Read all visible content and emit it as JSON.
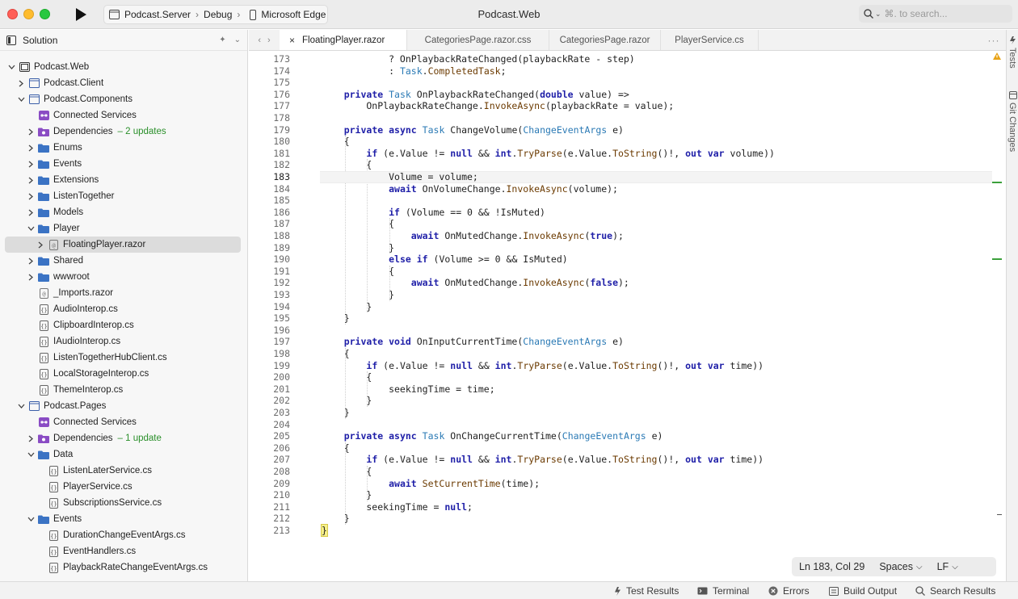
{
  "window": {
    "title": "Podcast.Web",
    "target": {
      "project": "Podcast.Server",
      "config": "Debug",
      "device": "Microsoft Edge"
    },
    "search_placeholder": "⌘. to search..."
  },
  "solution": {
    "header": "Solution",
    "items": [
      {
        "label": "Podcast.Web",
        "depth": 0,
        "chevron": "down",
        "icon": "solution-icon"
      },
      {
        "label": "Podcast.Client",
        "depth": 1,
        "chevron": "right",
        "icon": "project-icon"
      },
      {
        "label": "Podcast.Components",
        "depth": 1,
        "chevron": "down",
        "icon": "project-icon"
      },
      {
        "label": "Connected Services",
        "depth": 2,
        "chevron": "",
        "icon": "connected-services-icon"
      },
      {
        "label": "Dependencies",
        "badge": "– 2 updates",
        "depth": 2,
        "chevron": "right",
        "icon": "dependencies-icon"
      },
      {
        "label": "Enums",
        "depth": 2,
        "chevron": "right",
        "icon": "folder-icon"
      },
      {
        "label": "Events",
        "depth": 2,
        "chevron": "right",
        "icon": "folder-icon"
      },
      {
        "label": "Extensions",
        "depth": 2,
        "chevron": "right",
        "icon": "folder-icon"
      },
      {
        "label": "ListenTogether",
        "depth": 2,
        "chevron": "right",
        "icon": "folder-icon"
      },
      {
        "label": "Models",
        "depth": 2,
        "chevron": "right",
        "icon": "folder-icon"
      },
      {
        "label": "Player",
        "depth": 2,
        "chevron": "down",
        "icon": "folder-icon"
      },
      {
        "label": "FloatingPlayer.razor",
        "depth": 3,
        "chevron": "right",
        "icon": "razor-file-icon",
        "selected": true
      },
      {
        "label": "Shared",
        "depth": 2,
        "chevron": "right",
        "icon": "folder-icon"
      },
      {
        "label": "wwwroot",
        "depth": 2,
        "chevron": "right",
        "icon": "folder-icon"
      },
      {
        "label": "_Imports.razor",
        "depth": 2,
        "chevron": "",
        "icon": "razor-file-icon"
      },
      {
        "label": "AudioInterop.cs",
        "depth": 2,
        "chevron": "",
        "icon": "cs-file-icon"
      },
      {
        "label": "ClipboardInterop.cs",
        "depth": 2,
        "chevron": "",
        "icon": "cs-file-icon"
      },
      {
        "label": "IAudioInterop.cs",
        "depth": 2,
        "chevron": "",
        "icon": "cs-file-icon"
      },
      {
        "label": "ListenTogetherHubClient.cs",
        "depth": 2,
        "chevron": "",
        "icon": "cs-file-icon"
      },
      {
        "label": "LocalStorageInterop.cs",
        "depth": 2,
        "chevron": "",
        "icon": "cs-file-icon"
      },
      {
        "label": "ThemeInterop.cs",
        "depth": 2,
        "chevron": "",
        "icon": "cs-file-icon"
      },
      {
        "label": "Podcast.Pages",
        "depth": 1,
        "chevron": "down",
        "icon": "project-icon"
      },
      {
        "label": "Connected Services",
        "depth": 2,
        "chevron": "",
        "icon": "connected-services-icon"
      },
      {
        "label": "Dependencies",
        "badge": "– 1 update",
        "depth": 2,
        "chevron": "right",
        "icon": "dependencies-icon"
      },
      {
        "label": "Data",
        "depth": 2,
        "chevron": "down",
        "icon": "folder-icon"
      },
      {
        "label": "ListenLaterService.cs",
        "depth": 3,
        "chevron": "",
        "icon": "cs-file-icon"
      },
      {
        "label": "PlayerService.cs",
        "depth": 3,
        "chevron": "",
        "icon": "cs-file-icon"
      },
      {
        "label": "SubscriptionsService.cs",
        "depth": 3,
        "chevron": "",
        "icon": "cs-file-icon"
      },
      {
        "label": "Events",
        "depth": 2,
        "chevron": "down",
        "icon": "folder-icon"
      },
      {
        "label": "DurationChangeEventArgs.cs",
        "depth": 3,
        "chevron": "",
        "icon": "cs-file-icon"
      },
      {
        "label": "EventHandlers.cs",
        "depth": 3,
        "chevron": "",
        "icon": "cs-file-icon"
      },
      {
        "label": "PlaybackRateChangeEventArgs.cs",
        "depth": 3,
        "chevron": "",
        "icon": "cs-file-icon"
      }
    ]
  },
  "tabs": [
    {
      "label": "FloatingPlayer.razor",
      "active": true
    },
    {
      "label": "CategoriesPage.razor.css",
      "active": false
    },
    {
      "label": "CategoriesPage.razor",
      "active": false
    },
    {
      "label": "PlayerService.cs",
      "active": false
    }
  ],
  "editor": {
    "current_line": 183,
    "lines": [
      {
        "n": "173",
        "code": "            ? OnPlaybackRateChanged(playbackRate - step)"
      },
      {
        "n": "174",
        "code": "            : Task.CompletedTask;"
      },
      {
        "n": "175",
        "code": ""
      },
      {
        "n": "176",
        "code": "    private Task OnPlaybackRateChanged(double value) =>"
      },
      {
        "n": "177",
        "code": "        OnPlaybackRateChange.InvokeAsync(playbackRate = value);"
      },
      {
        "n": "178",
        "code": ""
      },
      {
        "n": "179",
        "code": "    private async Task ChangeVolume(ChangeEventArgs e)"
      },
      {
        "n": "180",
        "code": "    {"
      },
      {
        "n": "181",
        "code": "        if (e.Value != null && int.TryParse(e.Value.ToString()!, out var volume))"
      },
      {
        "n": "182",
        "code": "        {"
      },
      {
        "n": "183",
        "code": "            Volume = volume;"
      },
      {
        "n": "184",
        "code": "            await OnVolumeChange.InvokeAsync(volume);"
      },
      {
        "n": "185",
        "code": ""
      },
      {
        "n": "186",
        "code": "            if (Volume == 0 && !IsMuted)"
      },
      {
        "n": "187",
        "code": "            {"
      },
      {
        "n": "188",
        "code": "                await OnMutedChange.InvokeAsync(true);"
      },
      {
        "n": "189",
        "code": "            }"
      },
      {
        "n": "190",
        "code": "            else if (Volume >= 0 && IsMuted)"
      },
      {
        "n": "191",
        "code": "            {"
      },
      {
        "n": "192",
        "code": "                await OnMutedChange.InvokeAsync(false);"
      },
      {
        "n": "193",
        "code": "            }"
      },
      {
        "n": "194",
        "code": "        }"
      },
      {
        "n": "195",
        "code": "    }"
      },
      {
        "n": "196",
        "code": ""
      },
      {
        "n": "197",
        "code": "    private void OnInputCurrentTime(ChangeEventArgs e)"
      },
      {
        "n": "198",
        "code": "    {"
      },
      {
        "n": "199",
        "code": "        if (e.Value != null && int.TryParse(e.Value.ToString()!, out var time))"
      },
      {
        "n": "200",
        "code": "        {"
      },
      {
        "n": "201",
        "code": "            seekingTime = time;"
      },
      {
        "n": "202",
        "code": "        }"
      },
      {
        "n": "203",
        "code": "    }"
      },
      {
        "n": "204",
        "code": ""
      },
      {
        "n": "205",
        "code": "    private async Task OnChangeCurrentTime(ChangeEventArgs e)"
      },
      {
        "n": "206",
        "code": "    {"
      },
      {
        "n": "207",
        "code": "        if (e.Value != null && int.TryParse(e.Value.ToString()!, out var time))"
      },
      {
        "n": "208",
        "code": "        {"
      },
      {
        "n": "209",
        "code": "            await SetCurrentTime(time);"
      },
      {
        "n": "210",
        "code": "        }"
      },
      {
        "n": "211",
        "code": "        seekingTime = null;"
      },
      {
        "n": "212",
        "code": "    }"
      },
      {
        "n": "213",
        "code": "}"
      }
    ]
  },
  "status": {
    "position": "Ln 183, Col 29",
    "indent": "Spaces",
    "line_ending": "LF"
  },
  "right_sidebar": {
    "tests_label": "Tests",
    "git_label": "Git Changes"
  },
  "bottom_bar": {
    "test_results": "Test Results",
    "terminal": "Terminal",
    "errors": "Errors",
    "build_output": "Build Output",
    "search_results": "Search Results"
  },
  "colors": {
    "keyword": "#1f1fa8",
    "type": "#2b7ab5",
    "method": "#6b3a00",
    "folder": "#3b73c4",
    "accent_green": "#2a8f2a"
  }
}
